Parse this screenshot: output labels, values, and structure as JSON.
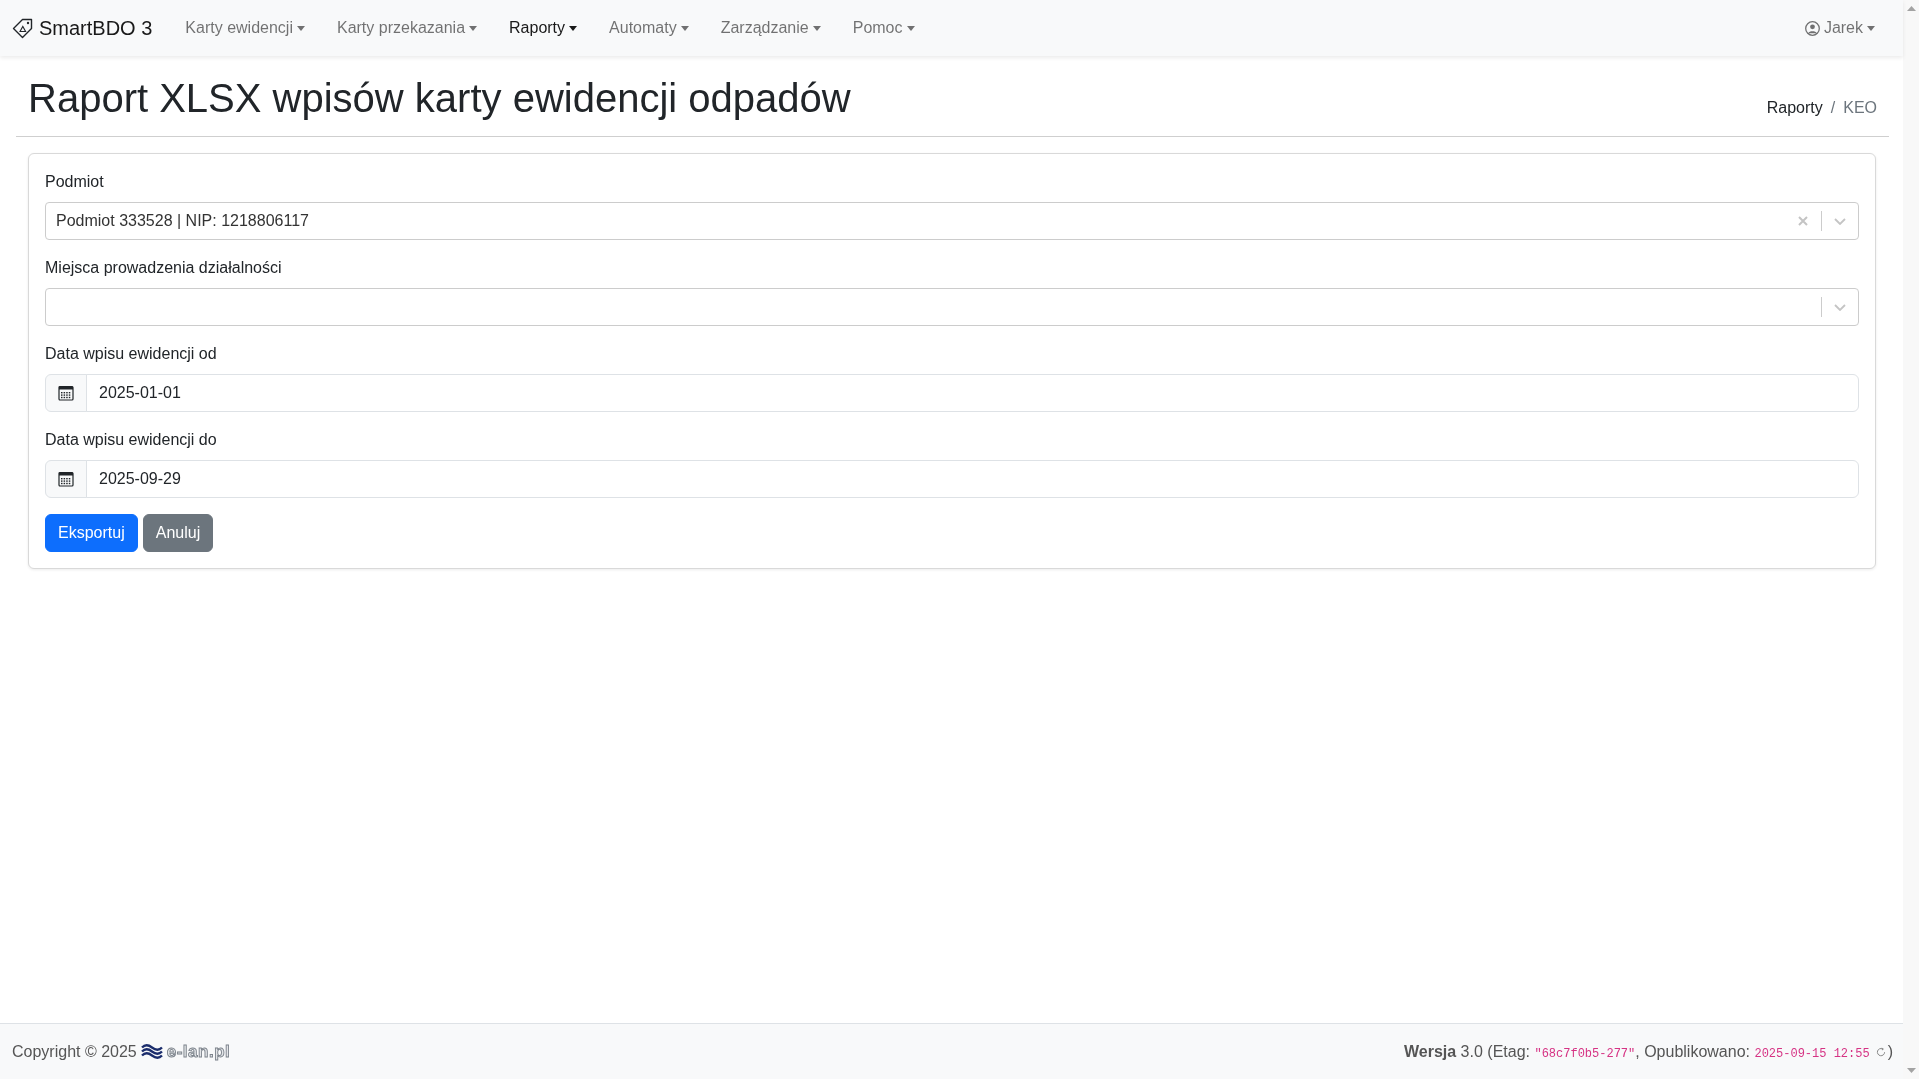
{
  "navbar": {
    "brand": "SmartBDO 3",
    "items": [
      {
        "label": "Karty ewidencji",
        "selected": false
      },
      {
        "label": "Karty przekazania",
        "selected": false
      },
      {
        "label": "Raporty",
        "selected": true
      },
      {
        "label": "Automaty",
        "selected": false
      },
      {
        "label": "Zarządzanie",
        "selected": false
      },
      {
        "label": "Pomoc",
        "selected": false
      }
    ],
    "user": {
      "label": "Jarek"
    }
  },
  "page": {
    "title": "Raport XLSX wpisów karty ewidencji odpadów",
    "breadcrumb": {
      "separator": "/",
      "items": [
        {
          "label": "Raporty",
          "kind": "link"
        },
        {
          "label": "KEO",
          "kind": "current"
        }
      ]
    }
  },
  "form": {
    "fields": [
      {
        "kind": "select",
        "label": "Podmiot",
        "value": "Podmiot 333528 | NIP: 1218806117"
      },
      {
        "kind": "select",
        "label": "Miejsca prowadzenia działalności"
      },
      {
        "kind": "date",
        "label": "Data wpisu ewidencji od",
        "value": "2025-01-01"
      },
      {
        "kind": "date",
        "label": "Data wpisu ewidencji do",
        "value": "2025-09-29"
      }
    ],
    "buttons": [
      {
        "label": "Eksportuj",
        "kind": "primary"
      },
      {
        "label": "Anuluj",
        "kind": "secondary"
      }
    ]
  },
  "footer": {
    "copyright": "Copyright © 2025",
    "logo_text": "e-lan.pl",
    "version": [
      {
        "kind": "text",
        "text": "**Wersja** 3.0 (Etag: "
      },
      {
        "kind": "code",
        "text": "\"68c7f0b5-277\""
      },
      {
        "kind": "text",
        "text": ", Opublikowano: "
      },
      {
        "kind": "code",
        "text": "2025-09-15 12:55"
      }
    ],
    "version_end": ")"
  }
}
